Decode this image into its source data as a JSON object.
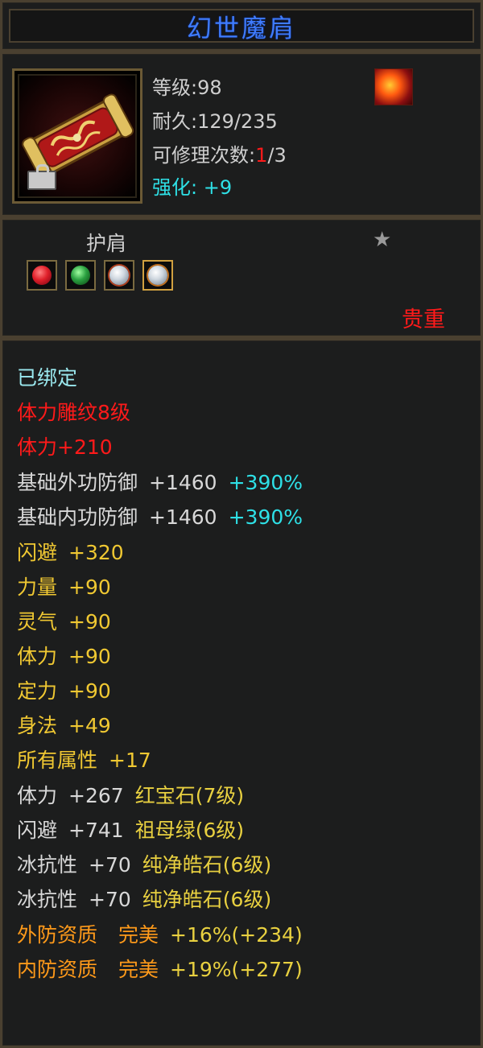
{
  "title": "幻世魔肩",
  "info": {
    "level_label": "等级",
    "level_value": "98",
    "durability_label": "耐久",
    "durability_value": "129/235",
    "repair_label": "可修理次数",
    "repair_current": "1",
    "repair_total": "/3",
    "enhance_label": "强化",
    "enhance_value": "+9"
  },
  "type": {
    "slot_name": "护肩",
    "rarity": "贵重",
    "star_icon": "star-icon",
    "gems": [
      {
        "name": "red-gem-icon",
        "color": "#e0202a"
      },
      {
        "name": "green-gem-icon",
        "color": "#2aa040"
      },
      {
        "name": "white-gem-icon",
        "color": "#d0d8e0"
      },
      {
        "name": "white-gem-icon",
        "color": "#d0d8e0"
      }
    ]
  },
  "stats": {
    "bound": "已绑定",
    "engrave": "体力雕纹8级",
    "stamina_bonus": "体力+210",
    "ext_def_label": "基础外功防御",
    "ext_def_value": "+1460",
    "ext_def_pct": "+390%",
    "int_def_label": "基础内功防御",
    "int_def_value": "+1460",
    "int_def_pct": "+390%",
    "dodge_label": "闪避",
    "dodge_value": "+320",
    "str_label": "力量",
    "str_value": "+90",
    "spirit_label": "灵气",
    "spirit_value": "+90",
    "stamina_label": "体力",
    "stamina_value": "+90",
    "focus_label": "定力",
    "focus_value": "+90",
    "agility_label": "身法",
    "agility_value": "+49",
    "all_attr_label": "所有属性",
    "all_attr_value": "+17",
    "gem1_attr": "体力",
    "gem1_value": "+267",
    "gem1_name": "红宝石(7级)",
    "gem2_attr": "闪避",
    "gem2_value": "+741",
    "gem2_name": "祖母绿(6级)",
    "gem3_attr": "冰抗性",
    "gem3_value": "+70",
    "gem3_name": "纯净皓石(6级)",
    "gem4_attr": "冰抗性",
    "gem4_value": "+70",
    "gem4_name": "纯净皓石(6级)",
    "ext_quality_label": "外防资质",
    "ext_quality_grade": "完美",
    "ext_quality_value": "+16%(+234)",
    "int_quality_label": "内防资质",
    "int_quality_grade": "完美",
    "int_quality_value": "+19%(+277)"
  },
  "colors": {
    "border": "#4a4030",
    "title": "#3f7cff",
    "red": "#ff1a1a",
    "cyan": "#2ee0e6",
    "yellow": "#f0c832",
    "orange": "#ff9a1a"
  }
}
